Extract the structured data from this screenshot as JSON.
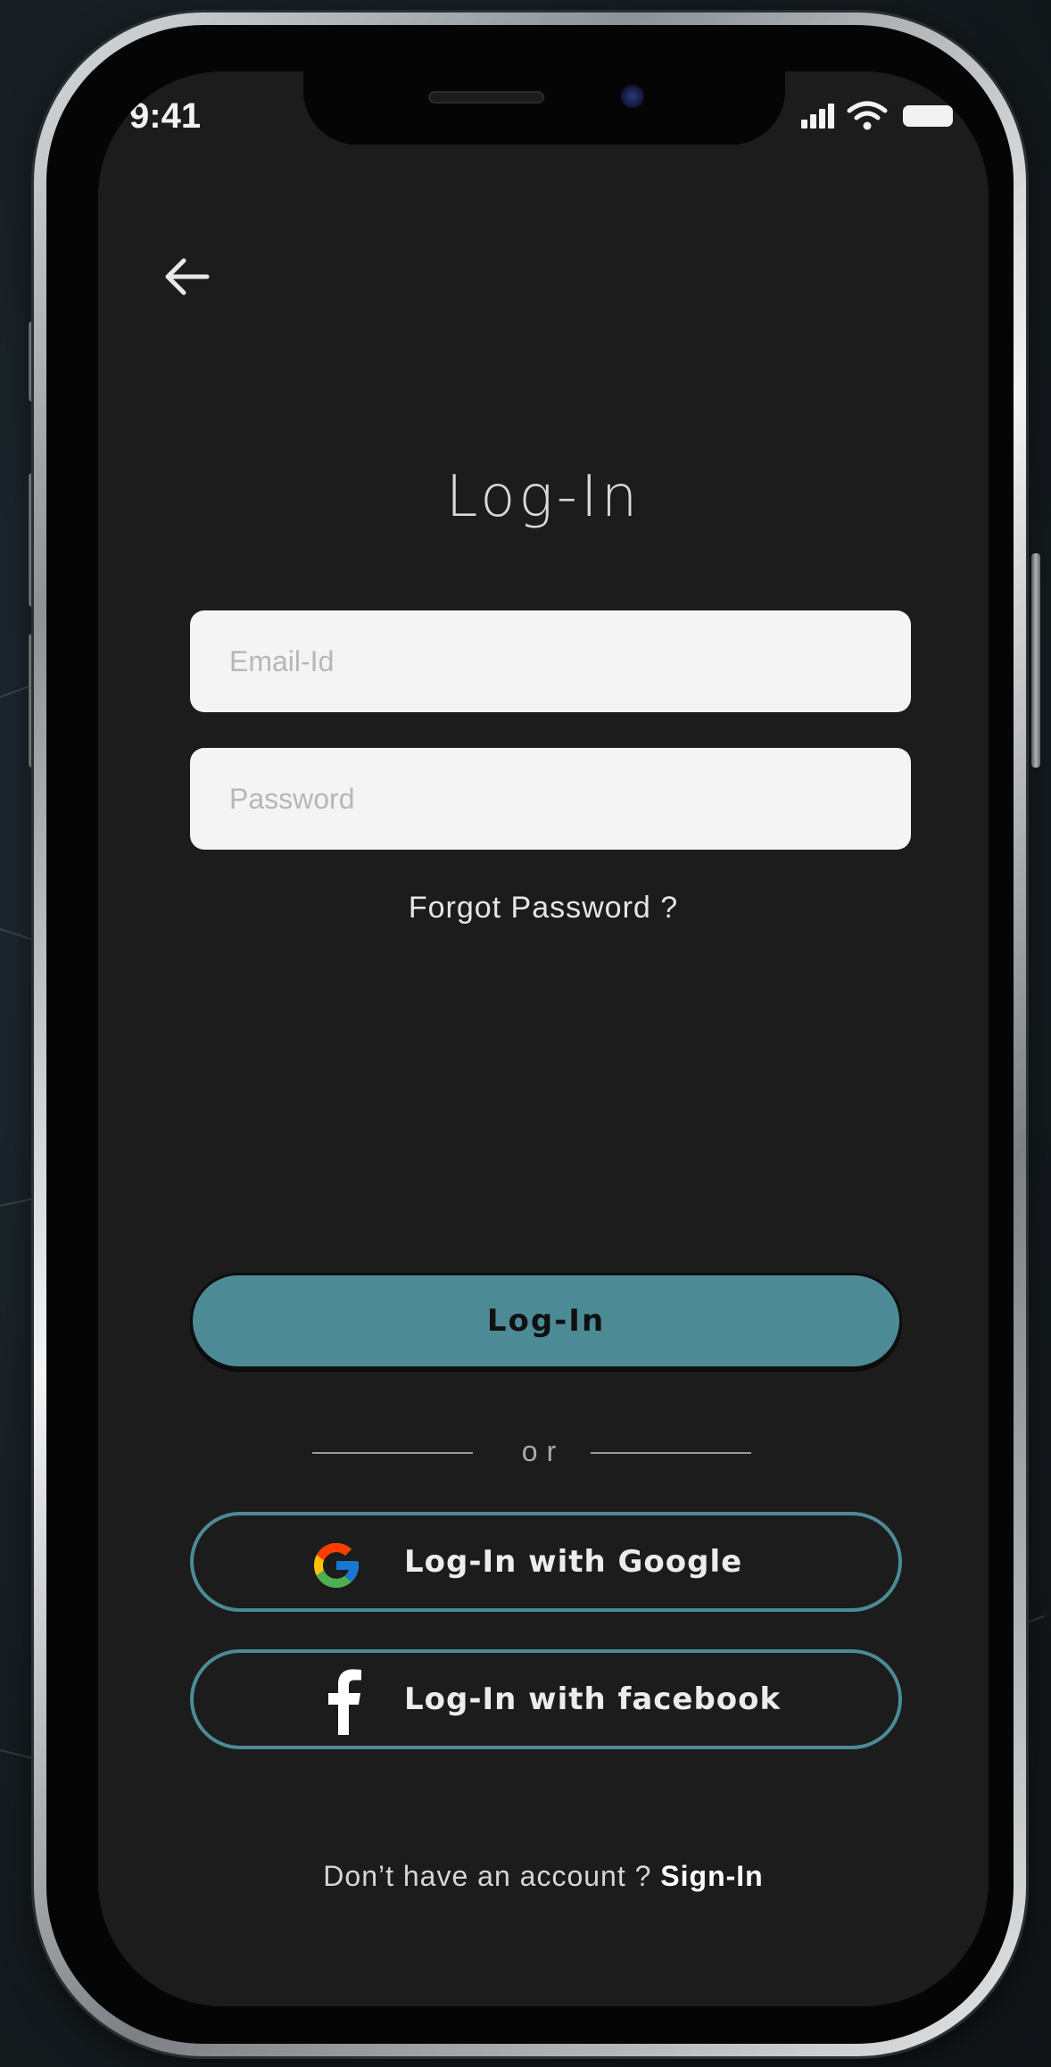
{
  "status_bar": {
    "time": "9:41",
    "icons": [
      "signal-icon",
      "wifi-icon",
      "battery-icon"
    ]
  },
  "nav": {
    "back_icon": "arrow-left-icon"
  },
  "title": "Log-In",
  "form": {
    "email_placeholder": "Email-Id",
    "email_value": "",
    "password_placeholder": "Password",
    "password_value": "",
    "forgot_label": "Forgot Password ?"
  },
  "login_button": {
    "label": "Log-In"
  },
  "divider": {
    "label": "or"
  },
  "social": {
    "google": {
      "label": "Log-In with Google",
      "icon": "google-icon"
    },
    "facebook": {
      "label": "Log-In with facebook",
      "icon": "facebook-icon"
    }
  },
  "footer": {
    "prompt": "Don’t have an account ?",
    "link": "Sign-In"
  },
  "colors": {
    "screen_bg": "#1c1c1c",
    "accent": "#4c8b96",
    "field_bg": "#f4f4f4",
    "text": "#ececec"
  }
}
